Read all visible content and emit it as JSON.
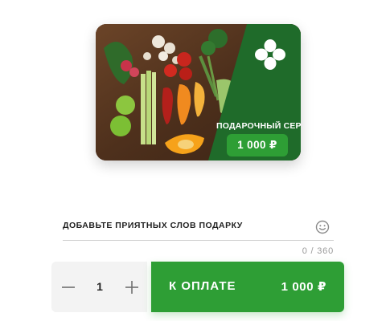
{
  "gift_card": {
    "title": "ПОДАРОЧНЫЙ СЕРТИФИКАТ",
    "price": "1 000 ₽",
    "logo_icon": "clover-logo-icon",
    "image": "vegetables-photo",
    "brand_color": "#1f6b2a",
    "accent_color": "#2e9e35"
  },
  "message": {
    "placeholder": "ДОБАВЬТЕ ПРИЯТНЫХ СЛОВ ПОДАРКУ",
    "value": "",
    "counter": "0 / 360",
    "emoji_icon": "smiley-icon"
  },
  "quantity": {
    "value": "1",
    "minus_icon": "minus-icon",
    "plus_icon": "plus-icon"
  },
  "pay_button": {
    "label": "К ОПЛАТЕ",
    "amount": "1 000 ₽",
    "color": "#2e9e35"
  }
}
